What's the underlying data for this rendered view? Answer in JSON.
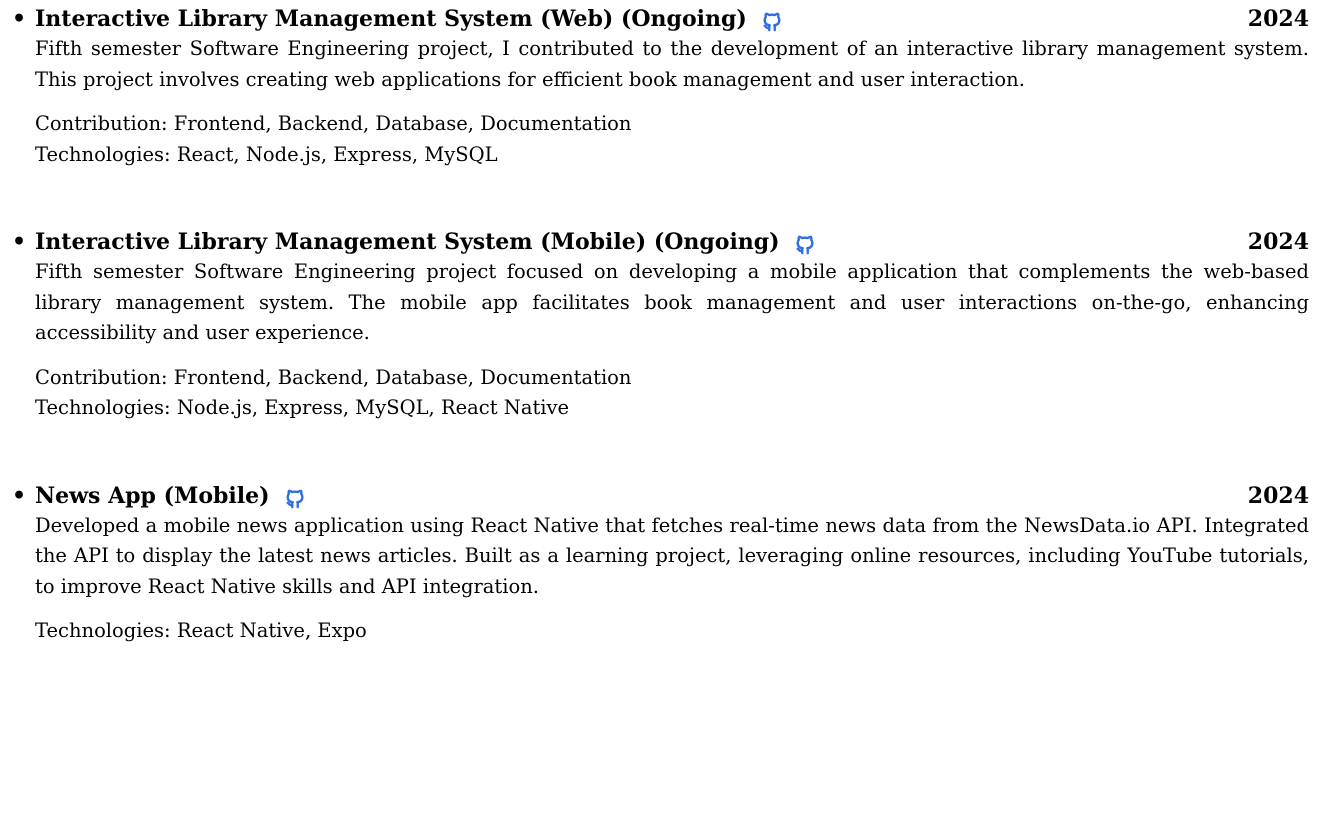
{
  "colors": {
    "text": "#000000",
    "github_icon": "#2f6fe0"
  },
  "projects": [
    {
      "title": "Interactive Library Management System (Web) (Ongoing)",
      "icon": "github-icon",
      "year": "2024",
      "description": "Fifth semester Software Engineering project, I contributed to the development of an interactive library management system. This project involves creating web applications for efficient book management and user interaction.",
      "contribution": "Contribution: Frontend, Backend, Database, Documentation",
      "technologies": "Technologies: React, Node.js, Express, MySQL"
    },
    {
      "title": "Interactive Library Management System (Mobile) (Ongoing)",
      "icon": "github-icon",
      "year": "2024",
      "description": "Fifth semester Software Engineering project focused on developing a mobile application that com­plements the web-based library management system. The mobile app facilitates book management and user interactions on-the-go, enhancing accessibility and user experience.",
      "contribution": "Contribution: Frontend, Backend, Database, Documentation",
      "technologies": "Technologies: Node.js, Express, MySQL, React Native"
    },
    {
      "title": "News App (Mobile)",
      "icon": "github-icon",
      "year": "2024",
      "description": "Developed a mobile news application using React Native that fetches real-time news data from the NewsData.io API. Integrated the API to display the latest news articles. Built as a learning project, leveraging online resources, including YouTube tutorials, to improve React Native skills and API integration.",
      "technologies": "Technologies: React Native, Expo"
    }
  ]
}
